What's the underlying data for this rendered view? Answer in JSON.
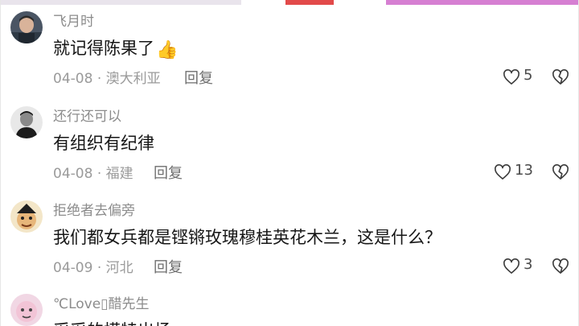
{
  "colors": {
    "strip_left": "#e9e4ec",
    "strip_mid": "#e24a4a",
    "strip_right": "#d67fd2",
    "text": "#161616",
    "muted": "#9a9a9a"
  },
  "comments": [
    {
      "username": "飞月时",
      "text": "就记得陈果了",
      "emoji": "👍",
      "date": "04-08",
      "location": "澳大利亚",
      "reply": "回复",
      "likes": "5",
      "avatar_icon": "avatar-man-photo"
    },
    {
      "username": "还行还可以",
      "text": "有组织有纪律",
      "date": "04-08",
      "location": "福建",
      "reply": "回复",
      "likes": "13",
      "avatar_icon": "avatar-bw-photo"
    },
    {
      "username": "拒绝者去偏旁",
      "text": "我们都女兵都是铿锵玫瑰穆桂英花木兰，这是什么？",
      "date": "04-09",
      "location": "河北",
      "reply": "回复",
      "likes": "3",
      "avatar_icon": "avatar-cartoon"
    },
    {
      "username": "℃Love▯醋先生",
      "text": "采采的模特出场",
      "avatar_icon": "avatar-pink-emoji"
    }
  ],
  "meta_separator": "·",
  "icons": {
    "like": "heart-outline-icon",
    "dislike": "broken-heart-icon"
  }
}
